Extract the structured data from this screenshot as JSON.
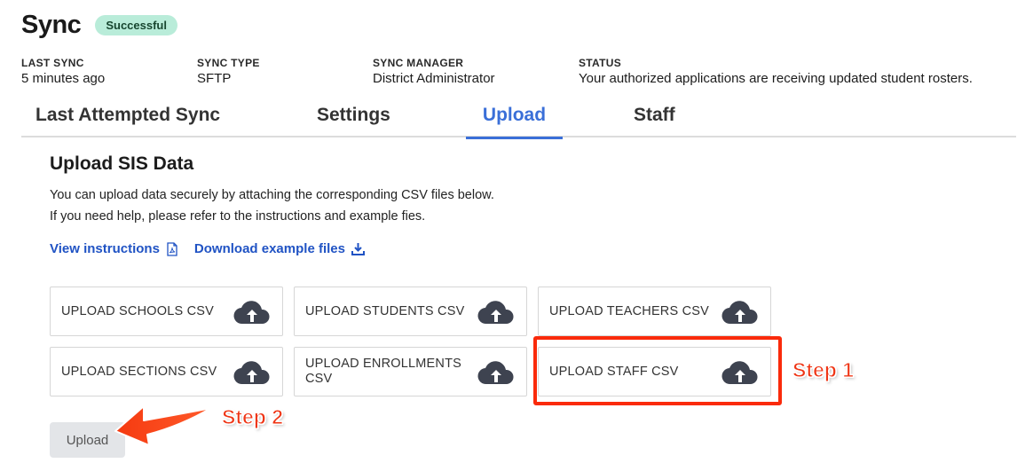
{
  "header": {
    "title": "Sync",
    "status_badge": "Successful"
  },
  "meta": {
    "last_sync": {
      "label": "LAST SYNC",
      "value": "5 minutes ago"
    },
    "sync_type": {
      "label": "SYNC TYPE",
      "value": "SFTP"
    },
    "sync_manager": {
      "label": "SYNC MANAGER",
      "value": "District Administrator"
    },
    "status": {
      "label": "STATUS",
      "value": "Your authorized applications are receiving updated student rosters."
    }
  },
  "tabs": [
    {
      "label": "Last Attempted Sync",
      "active": false
    },
    {
      "label": "Settings",
      "active": false
    },
    {
      "label": "Upload",
      "active": true
    },
    {
      "label": "Staff",
      "active": false
    }
  ],
  "upload": {
    "title": "Upload SIS Data",
    "desc_line1": "You can upload data securely by attaching the corresponding CSV files below.",
    "desc_line2": "If you need help, please refer to the instructions and example fies.",
    "view_instructions": "View instructions",
    "download_examples": "Download example files",
    "cards": [
      "UPLOAD SCHOOLS CSV",
      "UPLOAD STUDENTS CSV",
      "UPLOAD TEACHERS CSV",
      "UPLOAD SECTIONS CSV",
      "UPLOAD ENROLLMENTS CSV",
      "UPLOAD STAFF CSV"
    ],
    "upload_button": "Upload"
  },
  "annotations": {
    "step1": "Step 1",
    "step2": "Step 2"
  },
  "colors": {
    "accent": "#3a6fd8",
    "link": "#2053c4",
    "badge": "#b9ecd9",
    "annotation": "#fa2a0b",
    "cloud": "#3e4350"
  }
}
